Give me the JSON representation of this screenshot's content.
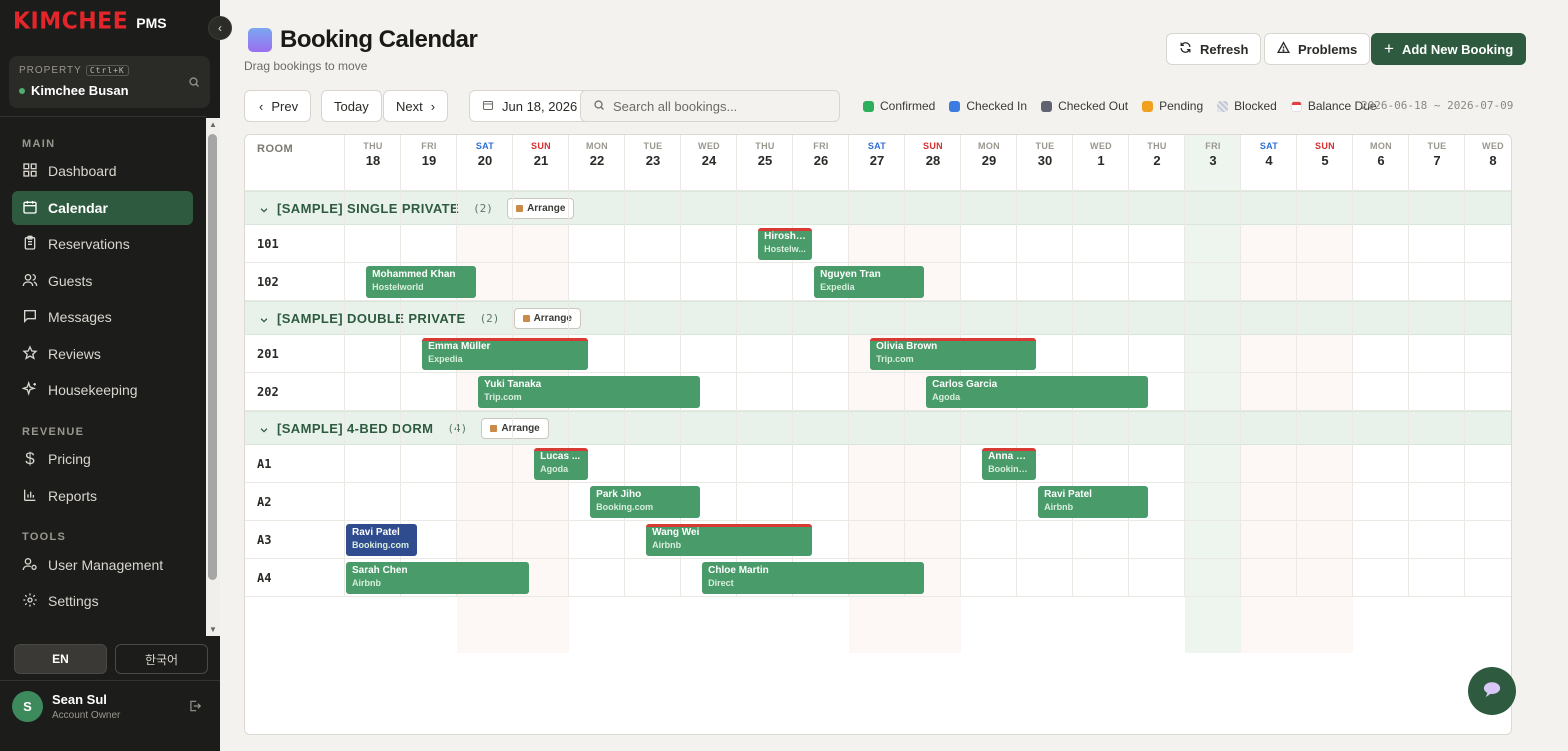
{
  "brand": {
    "logo": "KIMCHEE",
    "suffix": "PMS"
  },
  "property": {
    "label": "PROPERTY",
    "shortcut": "Ctrl+K",
    "name": "Kimchee Busan"
  },
  "nav": {
    "main_label": "MAIN",
    "main": [
      {
        "label": "Dashboard",
        "icon": "dashboard-icon"
      },
      {
        "label": "Calendar",
        "icon": "calendar-icon",
        "active": true
      },
      {
        "label": "Reservations",
        "icon": "clipboard-icon"
      },
      {
        "label": "Guests",
        "icon": "users-icon"
      },
      {
        "label": "Messages",
        "icon": "message-icon"
      },
      {
        "label": "Reviews",
        "icon": "star-icon"
      },
      {
        "label": "Housekeeping",
        "icon": "sparkle-icon"
      }
    ],
    "revenue_label": "REVENUE",
    "revenue": [
      {
        "label": "Pricing",
        "icon": "dollar-icon"
      },
      {
        "label": "Reports",
        "icon": "bar-chart-icon"
      }
    ],
    "tools_label": "TOOLS",
    "tools": [
      {
        "label": "User Management",
        "icon": "user-cog-icon"
      },
      {
        "label": "Settings",
        "icon": "gear-icon"
      }
    ]
  },
  "language": {
    "en": "EN",
    "ko": "한국어"
  },
  "user": {
    "initial": "S",
    "name": "Sean Sul",
    "role": "Account Owner"
  },
  "header": {
    "title": "Booking Calendar",
    "subtitle": "Drag bookings to move",
    "refresh": "Refresh",
    "problems": "Problems",
    "add": "Add New Booking"
  },
  "toolbar": {
    "prev": "Prev",
    "today": "Today",
    "next": "Next",
    "date": "Jun 18, 2026",
    "search_placeholder": "Search all bookings...",
    "range": "2026-06-18 ~ 2026-07-09"
  },
  "legend": [
    {
      "label": "Confirmed",
      "color": "#2fae5b"
    },
    {
      "label": "Checked In",
      "color": "#3c7be0"
    },
    {
      "label": "Checked Out",
      "color": "#5f6470"
    },
    {
      "label": "Pending",
      "color": "#f0a01e"
    },
    {
      "label": "Blocked",
      "color": "#c2c8d0"
    },
    {
      "label": "Balance Due",
      "color": "#e04040"
    }
  ],
  "calendar": {
    "room_header": "ROOM",
    "days": [
      {
        "name": "THU",
        "num": "18"
      },
      {
        "name": "FRI",
        "num": "19"
      },
      {
        "name": "SAT",
        "num": "20"
      },
      {
        "name": "SUN",
        "num": "21"
      },
      {
        "name": "MON",
        "num": "22"
      },
      {
        "name": "TUE",
        "num": "23"
      },
      {
        "name": "WED",
        "num": "24"
      },
      {
        "name": "THU",
        "num": "25"
      },
      {
        "name": "FRI",
        "num": "26"
      },
      {
        "name": "SAT",
        "num": "27"
      },
      {
        "name": "SUN",
        "num": "28"
      },
      {
        "name": "MON",
        "num": "29"
      },
      {
        "name": "TUE",
        "num": "30"
      },
      {
        "name": "WED",
        "num": "1"
      },
      {
        "name": "THU",
        "num": "2"
      },
      {
        "name": "FRI",
        "num": "3"
      },
      {
        "name": "SAT",
        "num": "4"
      },
      {
        "name": "SUN",
        "num": "5"
      },
      {
        "name": "MON",
        "num": "6"
      },
      {
        "name": "TUE",
        "num": "7"
      },
      {
        "name": "WED",
        "num": "8"
      }
    ],
    "today_index": 15,
    "arrange_label": "Arrange",
    "groups": [
      {
        "title": "[SAMPLE] SINGLE PRIVATE",
        "count": "(2)",
        "rooms": [
          "101",
          "102"
        ]
      },
      {
        "title": "[SAMPLE] DOUBLE PRIVATE",
        "count": "(2)",
        "rooms": [
          "201",
          "202"
        ]
      },
      {
        "title": "[SAMPLE] 4-BED DORM",
        "count": "(4)",
        "rooms": [
          "A1",
          "A2",
          "A3",
          "A4"
        ]
      }
    ],
    "bookings": [
      {
        "room": "101",
        "guest": "Hiroshi...",
        "source": "Hostelw...",
        "start": 7,
        "days": 1,
        "status": "confirmed",
        "balance_due": true
      },
      {
        "room": "102",
        "guest": "Mohammed Khan",
        "source": "Hostelworld",
        "start": 0,
        "days": 2,
        "status": "confirmed",
        "balance_due": false
      },
      {
        "room": "102",
        "guest": "Nguyen Tran",
        "source": "Expedia",
        "start": 8,
        "days": 2,
        "status": "confirmed",
        "balance_due": false
      },
      {
        "room": "201",
        "guest": "Emma Müller",
        "source": "Expedia",
        "start": 1,
        "days": 3,
        "status": "confirmed",
        "balance_due": true
      },
      {
        "room": "201",
        "guest": "Olivia Brown",
        "source": "Trip.com",
        "start": 9,
        "days": 3,
        "status": "confirmed",
        "balance_due": true
      },
      {
        "room": "202",
        "guest": "Yuki Tanaka",
        "source": "Trip.com",
        "start": 2,
        "days": 4,
        "status": "confirmed",
        "balance_due": false
      },
      {
        "room": "202",
        "guest": "Carlos Garcia",
        "source": "Agoda",
        "start": 10,
        "days": 4,
        "status": "confirmed",
        "balance_due": false
      },
      {
        "room": "A1",
        "guest": "Lucas ...",
        "source": "Agoda",
        "start": 3,
        "days": 1,
        "status": "confirmed",
        "balance_due": true
      },
      {
        "room": "A1",
        "guest": "Anna S...",
        "source": "Booking...",
        "start": 11,
        "days": 1,
        "status": "confirmed",
        "balance_due": true
      },
      {
        "room": "A2",
        "guest": "Park Jiho",
        "source": "Booking.com",
        "start": 4,
        "days": 2,
        "status": "confirmed",
        "balance_due": false
      },
      {
        "room": "A2",
        "guest": "Ravi Patel",
        "source": "Airbnb",
        "start": 12,
        "days": 2,
        "status": "confirmed",
        "balance_due": false
      },
      {
        "room": "A3",
        "guest": "Ravi Patel",
        "source": "Booking.com",
        "start": 0,
        "days": 1.3,
        "status": "checked-in",
        "balance_due": false
      },
      {
        "room": "A3",
        "guest": "Wang Wei",
        "source": "Airbnb",
        "start": 5,
        "days": 3,
        "status": "confirmed",
        "balance_due": true
      },
      {
        "room": "A4",
        "guest": "Sarah Chen",
        "source": "Airbnb",
        "start": 0,
        "days": 3.3,
        "status": "confirmed",
        "balance_due": false
      },
      {
        "room": "A4",
        "guest": "Chloe Martin",
        "source": "Direct",
        "start": 6,
        "days": 4,
        "status": "confirmed",
        "balance_due": false
      }
    ]
  }
}
